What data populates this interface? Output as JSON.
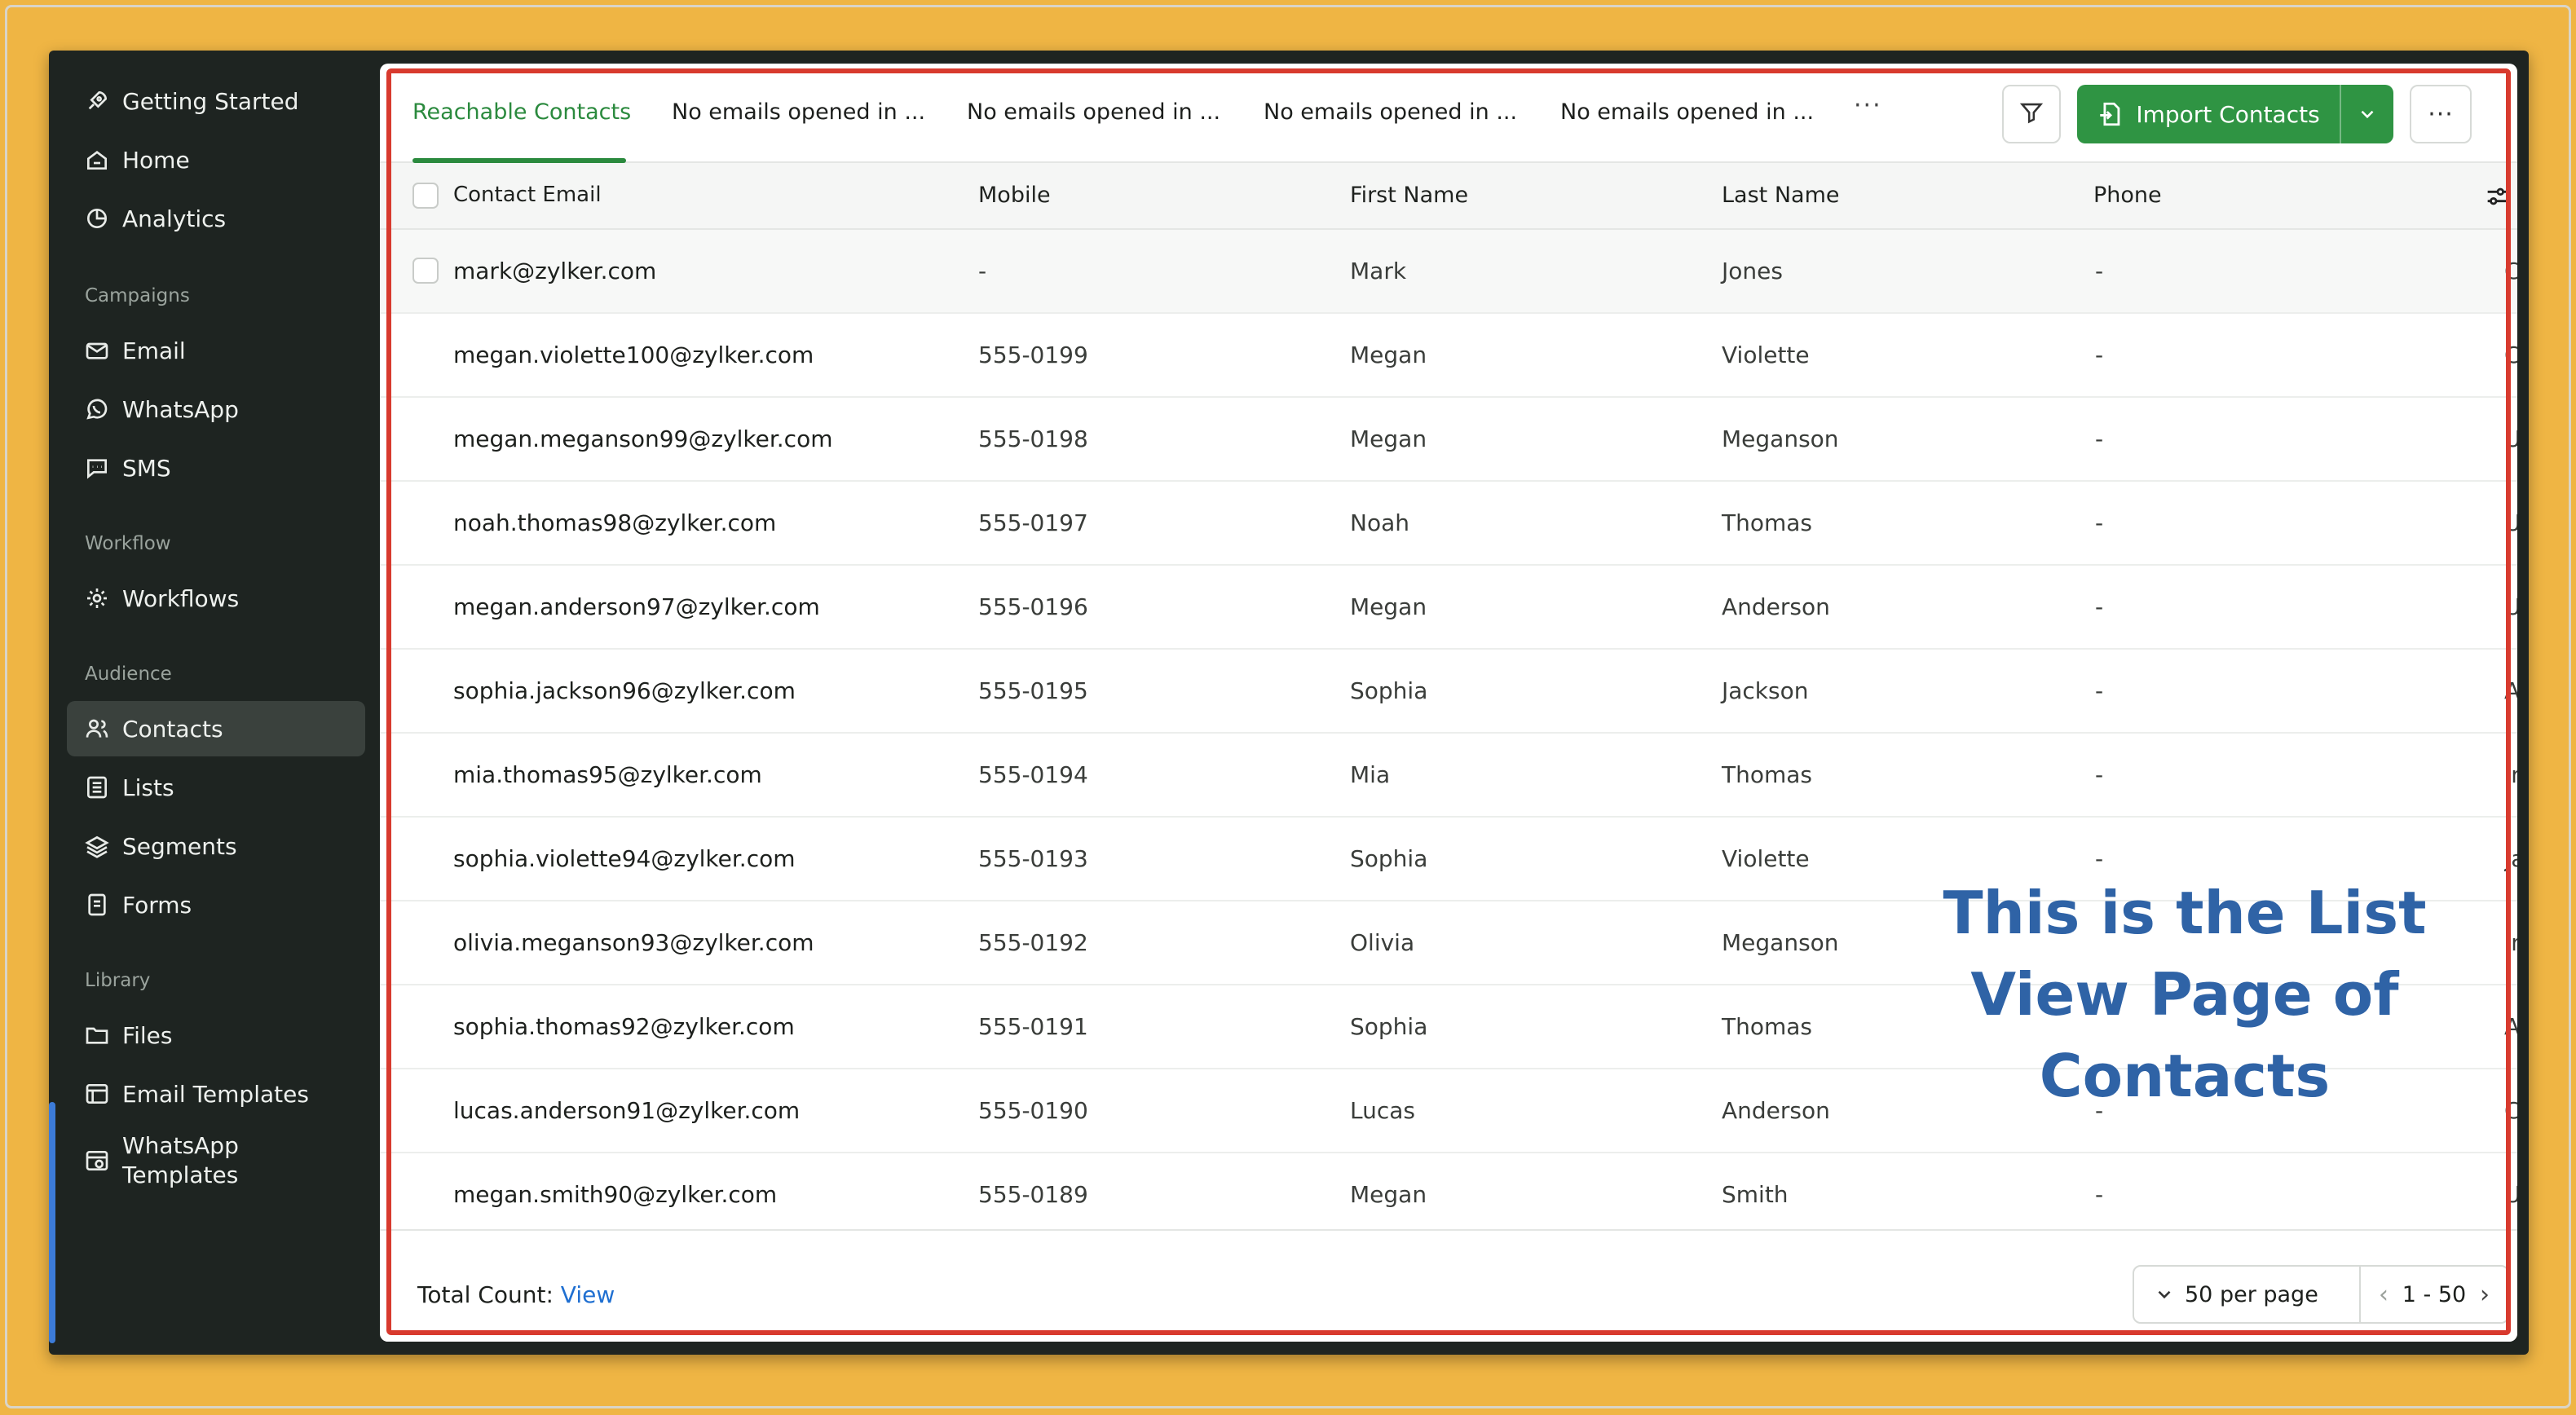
{
  "sidebar": {
    "getting_started": "Getting Started",
    "home": "Home",
    "analytics": "Analytics",
    "campaigns_label": "Campaigns",
    "email": "Email",
    "whatsapp": "WhatsApp",
    "sms": "SMS",
    "workflow_label": "Workflow",
    "workflows": "Workflows",
    "audience_label": "Audience",
    "contacts": "Contacts",
    "lists": "Lists",
    "segments": "Segments",
    "forms": "Forms",
    "library_label": "Library",
    "files": "Files",
    "email_templates": "Email Templates",
    "whatsapp_templates": "WhatsApp\nTemplates"
  },
  "tabs": [
    {
      "label": "Reachable Contacts"
    },
    {
      "label": "No emails opened in ..."
    },
    {
      "label": "No emails opened in ..."
    },
    {
      "label": "No emails opened in ..."
    },
    {
      "label": "No emails opened in ..."
    }
  ],
  "toolbar": {
    "more_tabs": "···",
    "import_label": "Import Contacts",
    "kebab": "···"
  },
  "table": {
    "headers": {
      "email": "Contact Email",
      "mobile": "Mobile",
      "first_name": "First Name",
      "last_name": "Last Name",
      "phone": "Phone"
    },
    "rows": [
      {
        "email": "mark@zylker.com",
        "mobile": "-",
        "first": "Mark",
        "last": "Jones",
        "phone": "-",
        "extra": "Ca"
      },
      {
        "email": "megan.violette100@zylker.com",
        "mobile": "555-0199",
        "first": "Megan",
        "last": "Violette",
        "phone": "-",
        "extra": "Ca"
      },
      {
        "email": "megan.meganson99@zylker.com",
        "mobile": "555-0198",
        "first": "Megan",
        "last": "Meganson",
        "phone": "-",
        "extra": "Uk"
      },
      {
        "email": "noah.thomas98@zylker.com",
        "mobile": "555-0197",
        "first": "Noah",
        "last": "Thomas",
        "phone": "-",
        "extra": "Uk"
      },
      {
        "email": "megan.anderson97@zylker.com",
        "mobile": "555-0196",
        "first": "Megan",
        "last": "Anderson",
        "phone": "-",
        "extra": "Uk"
      },
      {
        "email": "sophia.jackson96@zylker.com",
        "mobile": "555-0195",
        "first": "Sophia",
        "last": "Jackson",
        "phone": "-",
        "extra": "Au"
      },
      {
        "email": "mia.thomas95@zylker.com",
        "mobile": "555-0194",
        "first": "Mia",
        "last": "Thomas",
        "phone": "-",
        "extra": "In"
      },
      {
        "email": "sophia.violette94@zylker.com",
        "mobile": "555-0193",
        "first": "Sophia",
        "last": "Violette",
        "phone": "-",
        "extra": "Ja"
      },
      {
        "email": "olivia.meganson93@zylker.com",
        "mobile": "555-0192",
        "first": "Olivia",
        "last": "Meganson",
        "phone": "",
        "extra": "In"
      },
      {
        "email": "sophia.thomas92@zylker.com",
        "mobile": "555-0191",
        "first": "Sophia",
        "last": "Thomas",
        "phone": "",
        "extra": "Au"
      },
      {
        "email": "lucas.anderson91@zylker.com",
        "mobile": "555-0190",
        "first": "Lucas",
        "last": "Anderson",
        "phone": "-",
        "extra": "Ca"
      },
      {
        "email": "megan.smith90@zylker.com",
        "mobile": "555-0189",
        "first": "Megan",
        "last": "Smith",
        "phone": "-",
        "extra": "US"
      }
    ]
  },
  "footer": {
    "total_label": "Total Count:",
    "view_link": "View",
    "per_page": "50 per page",
    "range": "1 - 50",
    "prev": "‹",
    "next": "›"
  },
  "annotation": {
    "line1": "This is the List",
    "line2": "View Page of",
    "line3": "Contacts"
  },
  "colors": {
    "accent_green": "#2f9443",
    "highlight_red": "#D83A2E",
    "annotation_blue": "#2F63A6",
    "background_orange": "#EFB544"
  }
}
